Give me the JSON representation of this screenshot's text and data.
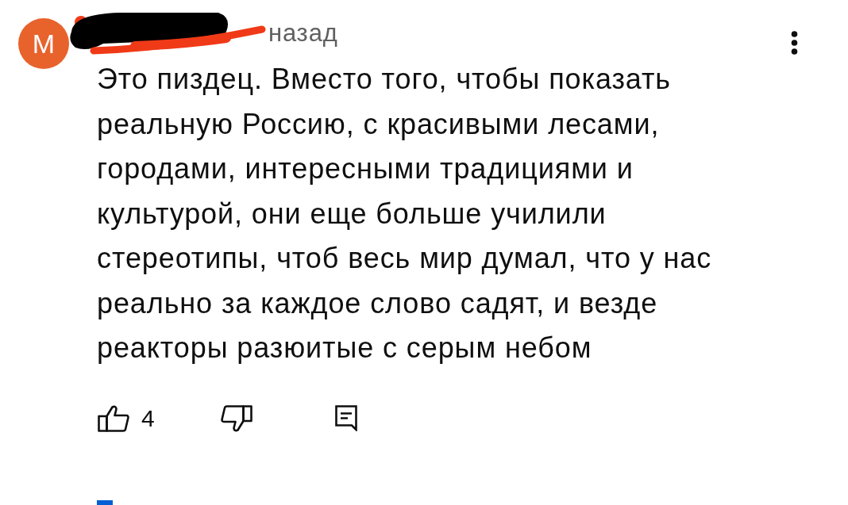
{
  "comment": {
    "avatar": {
      "letter": "M"
    },
    "time": "назад",
    "text": "Это пиздец. Вместо того, чтобы показать\nреальную Россию, с красивыми лесами,\nгородами, интересными традициями и\nкультурой, они еще больше училили\nстереотипы, чтоб весь мир думал, что у нас\nреально за каждое слово садят, и везде\nреакторы разюитые с серым небом",
    "actions": [
      {
        "kind": "like",
        "count": "4"
      },
      {
        "kind": "dislike"
      },
      {
        "kind": "reply"
      }
    ]
  }
}
